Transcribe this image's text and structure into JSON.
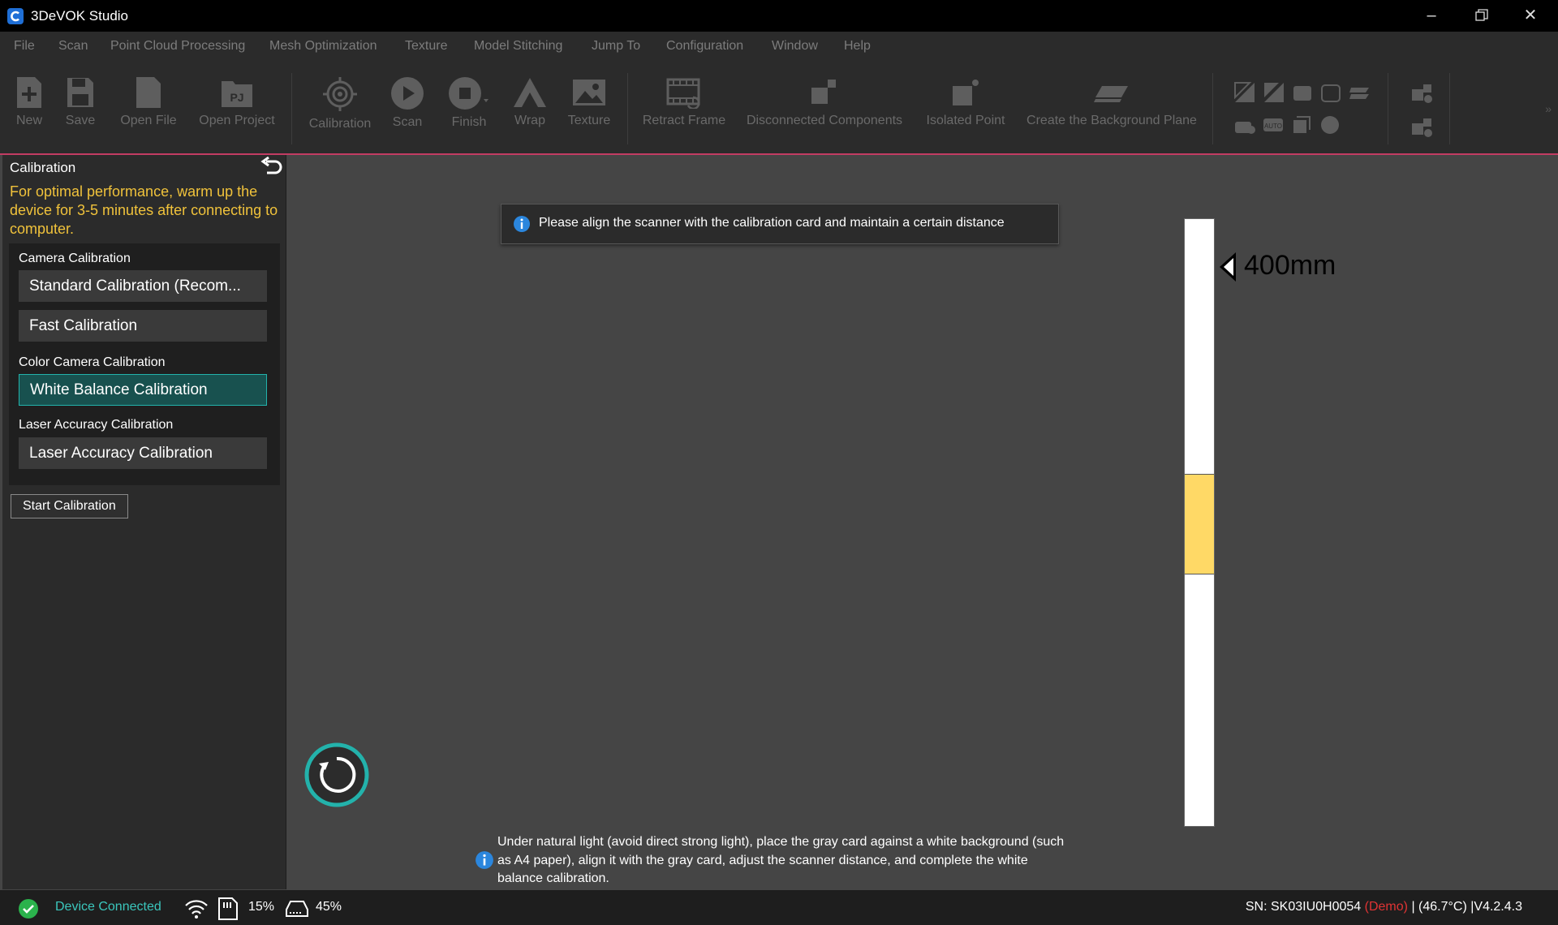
{
  "window": {
    "title": "3DeVOK Studio"
  },
  "menu": [
    "File",
    "Scan",
    "Point Cloud Processing",
    "Mesh Optimization",
    "Texture",
    "Model Stitching",
    "Jump To",
    "Configuration",
    "Window",
    "Help"
  ],
  "toolbar": {
    "new": "New",
    "save": "Save",
    "open_file": "Open File",
    "open_project": "Open Project",
    "calibration": "Calibration",
    "scan": "Scan",
    "finish": "Finish",
    "wrap": "Wrap",
    "texture": "Texture",
    "retract_frame": "Retract Frame",
    "disconnected_components": "Disconnected Components",
    "isolated_point": "Isolated Point",
    "create_background_plane": "Create the Background Plane",
    "project_icon_text": "PJ"
  },
  "sidebar": {
    "title": "Calibration",
    "warning": "For optimal performance, warm up the device for 3-5 minutes after connecting to computer.",
    "camera_section": "Camera Calibration",
    "standard_btn": "Standard Calibration (Recom...",
    "fast_btn": "Fast Calibration",
    "color_section": "Color Camera Calibration",
    "white_balance_btn": "White Balance Calibration",
    "laser_section": "Laser Accuracy Calibration",
    "laser_btn": "Laser Accuracy Calibration",
    "start_btn": "Start Calibration"
  },
  "viewport": {
    "tooltip": "Please align the scanner with the calibration card and maintain a certain distance",
    "distance": "400mm",
    "distance_level": 0.0,
    "target_band_start": 0.42,
    "target_band_end": 0.585,
    "hint": "Under natural light (avoid direct strong light), place the gray card against a white background (such as A4 paper), align it with the gray card, adjust the scanner distance, and complete the white balance calibration."
  },
  "status": {
    "connection": "Device Connected",
    "sd_percent": "15%",
    "disk_percent": "45%",
    "serial": "SN: SK03IU0H0054",
    "demo": "(Demo)",
    "temp_version": "| (46.7°C) |V4.2.4.3"
  },
  "colors": {
    "accent": "#23b2ab",
    "warning": "#f0c23b",
    "band": "#ffd966",
    "demo": "#e03434",
    "toolbar_border": "#c23c63"
  }
}
